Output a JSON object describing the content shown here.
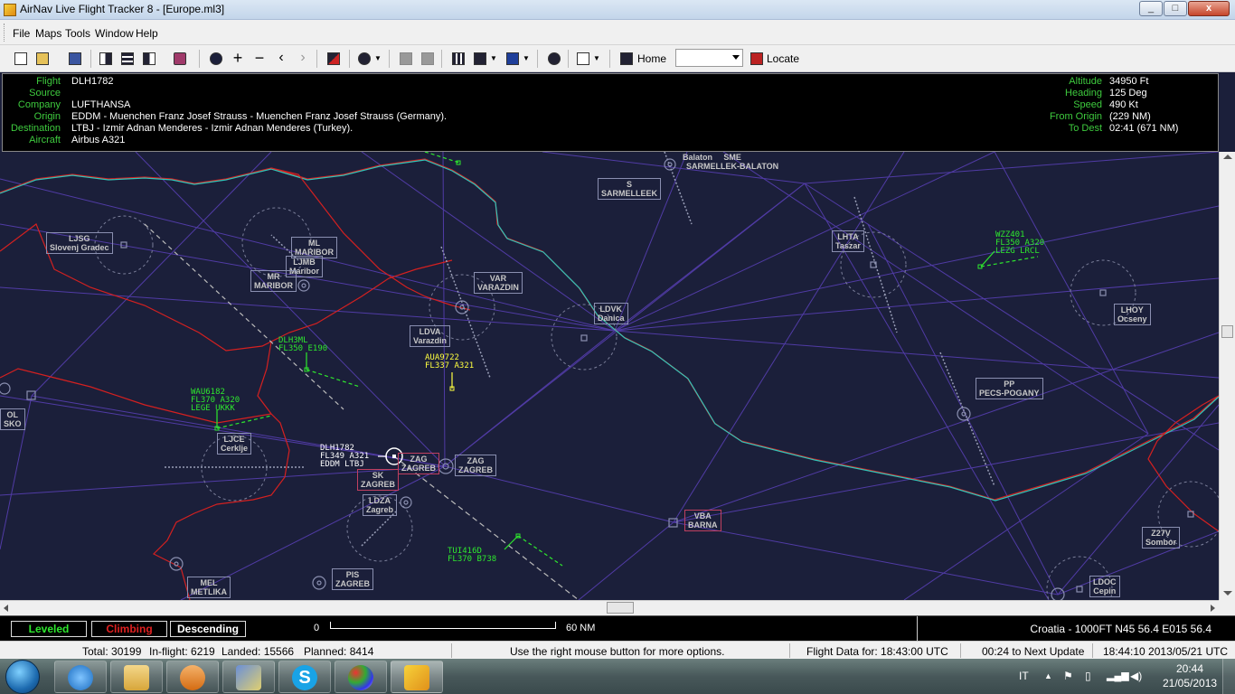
{
  "window": {
    "title": "AirNav Live Flight Tracker 8 - [Europe.ml3]",
    "minimize": "_",
    "maximize": "□",
    "close": "x"
  },
  "menu": [
    "File",
    "Maps",
    "Tools",
    "Window",
    "Help"
  ],
  "toolbar": {
    "home_label": "Home",
    "locate_label": "Locate",
    "combo_value": ""
  },
  "flight_info": {
    "labels": {
      "flight": "Flight",
      "source": "Source",
      "company": "Company",
      "origin": "Origin",
      "destination": "Destination",
      "aircraft": "Aircraft",
      "altitude": "Altitude",
      "heading": "Heading",
      "speed": "Speed",
      "from_origin": "From Origin",
      "to_dest": "To Dest"
    },
    "flight": "DLH1782",
    "source": "",
    "company": "LUFTHANSA",
    "origin": "EDDM - Muenchen Franz Josef Strauss - Muenchen Franz Josef Strauss (Germany).",
    "destination": "LTBJ - Izmir Adnan Menderes - Izmir Adnan Menderes (Turkey).",
    "aircraft": "Airbus A321",
    "altitude": "34950 Ft",
    "heading": "125 Deg",
    "speed": "490 Kt",
    "from_origin": " (229 NM)",
    "to_dest": "02:41 (671 NM)"
  },
  "map": {
    "colors": {
      "background": "#1b1f3a",
      "border_red": "#d42020",
      "border_cyan": "#31c4b8",
      "route": "#6a50c8",
      "fix": "#8a8fb0",
      "label": "#c8c8c8",
      "flight_green": "#2ee82e",
      "flight_yellow": "#ffff40",
      "flight_white": "#ffffff"
    },
    "waypoints": [
      {
        "id": "Balaton",
        "name": ""
      },
      {
        "id": "SME",
        "name": "SARMELLEK-BALATON"
      },
      {
        "id": "S",
        "name": "SARMELLEEK"
      },
      {
        "id": "LJSG",
        "name": "Slovenj Gradec"
      },
      {
        "id": "ML",
        "name": "MARIBOR"
      },
      {
        "id": "LJMB",
        "name": "Maribor"
      },
      {
        "id": "MR",
        "name": "MARIBOR"
      },
      {
        "id": "VAR",
        "name": "VARAZDIN"
      },
      {
        "id": "LDVK",
        "name": "Danica"
      },
      {
        "id": "LDVA",
        "name": "Varazdin"
      },
      {
        "id": "LHTA",
        "name": "Taszar"
      },
      {
        "id": "LHOY",
        "name": "Ocseny"
      },
      {
        "id": "PP",
        "name": "PECS-POGANY"
      },
      {
        "id": "LJCE",
        "name": "Cerklje"
      },
      {
        "id": "ZAG",
        "name": "ZAGREB"
      },
      {
        "id": "ZAG",
        "name": "ZAGREB"
      },
      {
        "id": "SK",
        "name": "ZAGREB"
      },
      {
        "id": "LDZA",
        "name": "Zagreb"
      },
      {
        "id": "VBA",
        "name": "BARNA"
      },
      {
        "id": "Z27V",
        "name": "Sombor"
      },
      {
        "id": "MEL",
        "name": "METLIKA"
      },
      {
        "id": "PIS",
        "name": "ZAGREB"
      },
      {
        "id": "LDOC",
        "name": "Cepin"
      },
      {
        "id": "OL",
        "name": "SKO"
      }
    ],
    "flights": [
      {
        "l1": "WZZ401",
        "l2": "FL350 A320",
        "l3": "LEZG LRCL"
      },
      {
        "l1": "DLH3ML",
        "l2": "FL350 E190",
        "l3": ""
      },
      {
        "l1": "AUA9722",
        "l2": "FL337 A321",
        "l3": ""
      },
      {
        "l1": "WAU6182",
        "l2": "FL370 A320",
        "l3": "LEGE UKKK"
      },
      {
        "l1": "DLH1782",
        "l2": "FL349 A321",
        "l3": "EDDM LTBJ"
      },
      {
        "l1": "TUI416D",
        "l2": "FL370 B738",
        "l3": ""
      }
    ]
  },
  "legend": {
    "leveled": "Leveled",
    "climbing": "Climbing",
    "descending": "Descending",
    "scale_start": "0",
    "scale_end": "60 NM",
    "position": "Croatia  - 1000FT N45 56.4 E015 56.4"
  },
  "status": {
    "total": "Total: 30199",
    "inflight": "In-flight: 6219",
    "landed": "Landed: 15566",
    "planned": "Planned: 8414",
    "hint": "Use the right mouse button for more options.",
    "flight_data": "Flight Data for: 18:43:00 UTC",
    "next_update": "00:24 to Next Update",
    "clock": "18:44:10 2013/05/21 UTC"
  },
  "taskbar": {
    "lang": "IT",
    "time": "20:44",
    "date": "21/05/2013",
    "apps": [
      "start-orb",
      "internet-explorer",
      "file-explorer",
      "media-player",
      "airnav-radarbox",
      "skype",
      "paint",
      "airnav-tracker"
    ]
  }
}
